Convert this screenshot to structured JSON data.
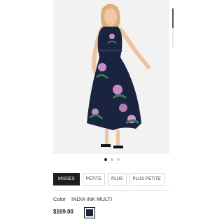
{
  "product": {
    "image_alt": "Woman wearing navy floral sleeveless maxi dress",
    "carousel": {
      "slides": 3,
      "active": 0
    },
    "size_tabs": [
      "MISSES",
      "PETITE",
      "PLUS",
      "PLUS PETITE"
    ],
    "selected_size_tab": "MISSES",
    "color_label": "Color",
    "color_value": "INDIA INK MULTI",
    "price": "$169.00",
    "swatch_color": "#1a2340"
  },
  "colors": {
    "dress_base": "#1a2340",
    "floral_pink": "#c98cc0",
    "floral_green": "#3f7a52",
    "image_bg": "#f2f2f2"
  }
}
